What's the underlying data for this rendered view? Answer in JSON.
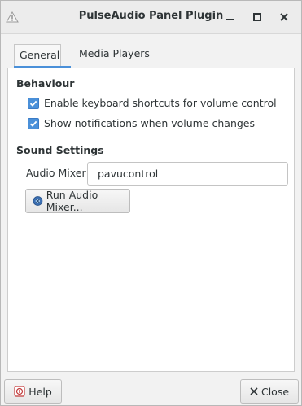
{
  "window": {
    "title": "PulseAudio Panel Plugin",
    "icons": {
      "app": "warning-triangle-icon",
      "minimize": "minimize-icon",
      "maximize": "maximize-icon",
      "close": "close-icon"
    }
  },
  "tabs": [
    {
      "label": "General",
      "active": true
    },
    {
      "label": "Media Players",
      "active": false
    }
  ],
  "general": {
    "behaviour_title": "Behaviour",
    "options": [
      {
        "label": "Enable keyboard shortcuts for volume control",
        "checked": true
      },
      {
        "label": "Show notifications when volume changes",
        "checked": true
      }
    ],
    "sound_settings_title": "Sound Settings",
    "audio_mixer_label": "Audio Mixer",
    "audio_mixer_value": "pavucontrol",
    "run_button_label": "Run Audio Mixer..."
  },
  "footer": {
    "help_label": "Help",
    "close_label": "Close"
  },
  "colors": {
    "accent": "#4a90d9",
    "background": "#f2f2f2",
    "panel": "#ffffff"
  }
}
